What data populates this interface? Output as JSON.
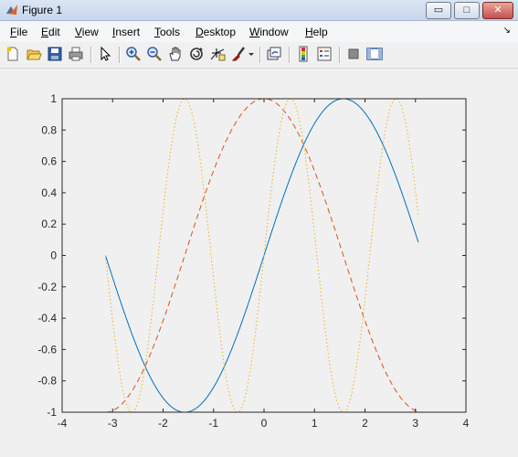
{
  "window": {
    "title": "Figure 1",
    "controls": {
      "minimize": "▭",
      "maximize": "□",
      "close": "✕"
    }
  },
  "menu": {
    "items": [
      {
        "accel": "F",
        "rest": "ile"
      },
      {
        "accel": "E",
        "rest": "dit"
      },
      {
        "accel": "V",
        "rest": "iew"
      },
      {
        "accel": "I",
        "rest": "nsert"
      },
      {
        "accel": "T",
        "rest": "ools"
      },
      {
        "accel": "D",
        "rest": "esktop"
      },
      {
        "accel": "W",
        "rest": "indow"
      },
      {
        "accel": "H",
        "rest": "elp"
      }
    ],
    "dock_glyph": "↘"
  },
  "toolbar": {
    "icons": [
      "new-figure-icon",
      "open-file-icon",
      "save-icon",
      "print-icon",
      "select-arrow-icon",
      "zoom-in-icon",
      "zoom-out-icon",
      "pan-hand-icon",
      "rotate-3d-icon",
      "data-cursor-icon",
      "brush-icon",
      "brush-dropdown-icon",
      "link-plot-icon",
      "colorbar-icon",
      "legend-icon",
      "hide-plot-tools-icon",
      "show-plot-tools-icon"
    ]
  },
  "colors": {
    "sine": "#0072bd",
    "cosine": "#d95319",
    "dotted": "#edb120"
  },
  "chart_data": {
    "type": "line",
    "title": "",
    "xlabel": "",
    "ylabel": "",
    "xlim": [
      -4,
      4
    ],
    "ylim": [
      -1,
      1
    ],
    "xticks": [
      -4,
      -3,
      -2,
      -1,
      0,
      1,
      2,
      3,
      4
    ],
    "yticks": [
      -1,
      -0.8,
      -0.6,
      -0.4,
      -0.2,
      0,
      0.2,
      0.4,
      0.6,
      0.8,
      1
    ],
    "xtick_labels": [
      "-4",
      "-3",
      "-2",
      "-1",
      "0",
      "1",
      "2",
      "3",
      "4"
    ],
    "ytick_labels": [
      "-1",
      "-0.8",
      "-0.6",
      "-0.4",
      "-0.2",
      "0",
      "0.2",
      "0.4",
      "0.6",
      "0.8",
      "1"
    ],
    "grid": false,
    "series": [
      {
        "style": "solid",
        "color": "#0072bd",
        "function": "sin(x)",
        "x_start": -3.1416,
        "x_end": 3.0584,
        "x_step": 0.1
      },
      {
        "style": "dashed",
        "color": "#d95319",
        "function": "cos(x)",
        "x_start": -3.1416,
        "x_end": 3.0584,
        "x_step": 0.1
      },
      {
        "style": "dotted",
        "color": "#edb120",
        "function": "sin(3x)",
        "x_start": -3.1416,
        "x_end": 3.0584,
        "x_step": 0.1
      }
    ]
  }
}
